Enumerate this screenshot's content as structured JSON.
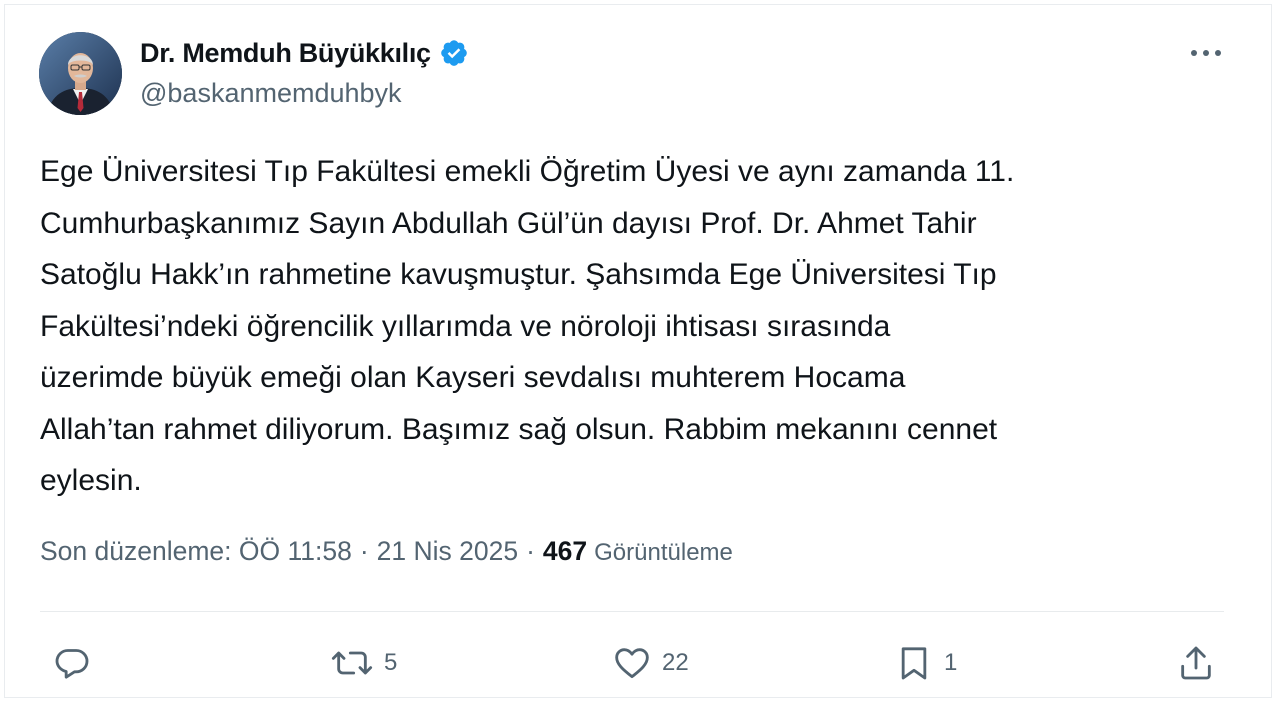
{
  "author": {
    "display_name": "Dr. Memduh Büyükkılıç",
    "handle": "@baskanmemduhbyk",
    "verified": true,
    "verified_color": "#1d9bf0"
  },
  "tweet": {
    "lines": [
      "Ege Üniversitesi Tıp Fakültesi emekli Öğretim Üyesi ve aynı zamanda 11.",
      "Cumhurbaşkanımız Sayın Abdullah Gül’ün dayısı Prof. Dr. Ahmet Tahir",
      "Satoğlu Hakk’ın rahmetine kavuşmuştur. Şahsımda Ege Üniversitesi Tıp",
      "Fakültesi’ndeki öğrencilik yıllarımda ve nöroloji ihtisası sırasında",
      "üzerimde büyük emeği olan Kayseri sevdalısı muhterem Hocama",
      "Allah’tan rahmet diliyorum. Başımız sağ olsun. Rabbim mekanını cennet",
      "eylesin."
    ]
  },
  "meta": {
    "edited_time": "Son düzenleme: ÖÖ 11:58",
    "separator": "·",
    "date": "21 Nis 2025",
    "views_count": "467",
    "views_label": "Görüntüleme"
  },
  "actions": {
    "reply": {
      "icon": "reply-icon",
      "count": ""
    },
    "retweet": {
      "icon": "retweet-icon",
      "count": "5"
    },
    "like": {
      "icon": "heart-icon",
      "count": "22"
    },
    "bookmark": {
      "icon": "bookmark-icon",
      "count": "1"
    },
    "share": {
      "icon": "share-icon",
      "count": ""
    }
  },
  "colors": {
    "text_primary": "#0f1419",
    "text_secondary": "#536471",
    "divider": "#e8ebed"
  }
}
